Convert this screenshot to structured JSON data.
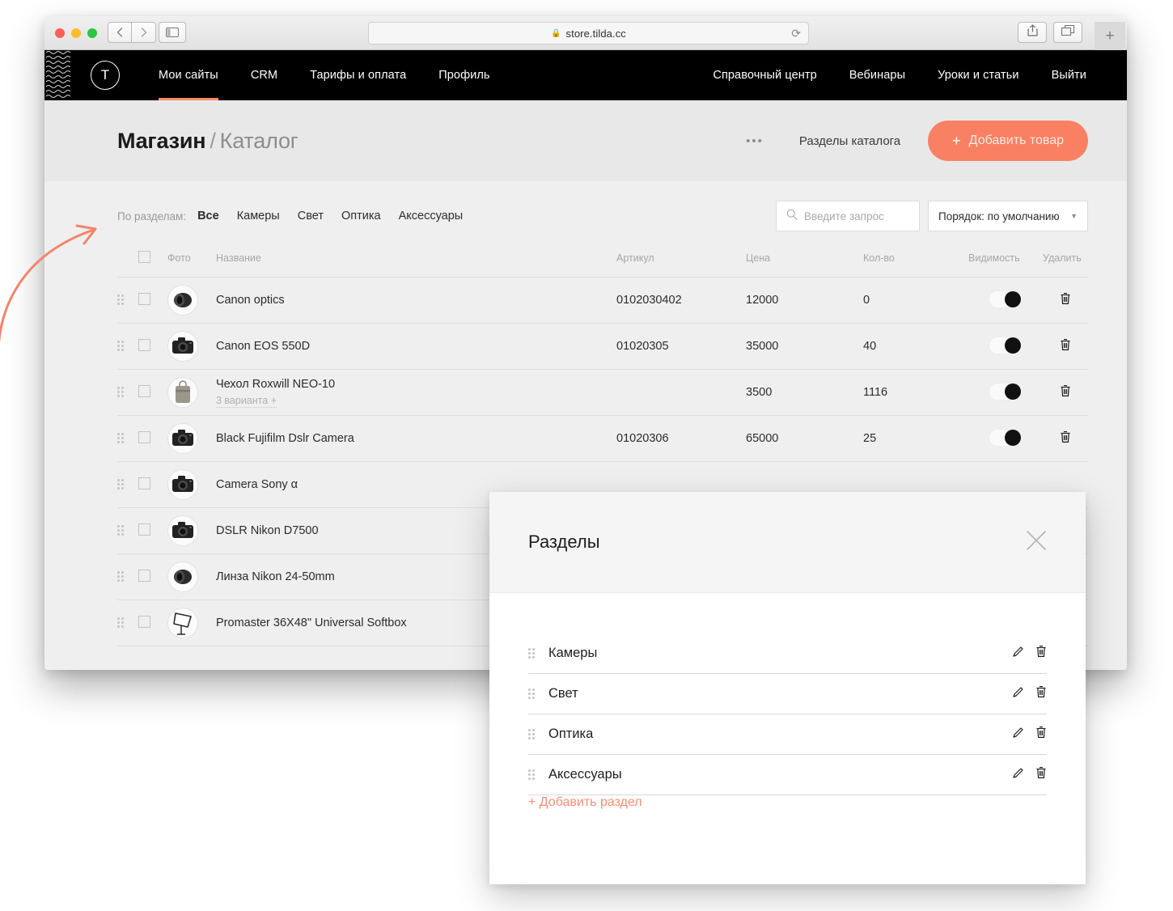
{
  "browser": {
    "url": "store.tilda.cc",
    "lock_icon": "lock-icon",
    "reload_icon": "reload-icon",
    "back_icon": "chevron-left-icon",
    "forward_icon": "chevron-right-icon",
    "sidebar_icon": "sidebar-toggle-icon",
    "share_icon": "share-icon",
    "tabs_icon": "show-tabs-icon",
    "newtab_label": "+"
  },
  "topnav": {
    "logo": "T",
    "left_items": [
      {
        "label": "Мои сайты",
        "active": true
      },
      {
        "label": "CRM",
        "active": false
      },
      {
        "label": "Тарифы и оплата",
        "active": false
      },
      {
        "label": "Профиль",
        "active": false
      }
    ],
    "right_items": [
      {
        "label": "Справочный центр"
      },
      {
        "label": "Вебинары"
      },
      {
        "label": "Уроки и статьи"
      },
      {
        "label": "Выйти"
      }
    ]
  },
  "pagehead": {
    "crumb_primary": "Магазин",
    "crumb_separator": "/",
    "crumb_secondary": "Каталог",
    "more_dots": "•••",
    "sections_link": "Разделы каталога",
    "add_button_plus": "+",
    "add_button_label": "Добавить товар",
    "accent_color": "#fa8064"
  },
  "filters": {
    "label": "По разделам:",
    "chips": [
      {
        "label": "Все",
        "selected": true
      },
      {
        "label": "Камеры",
        "selected": false
      },
      {
        "label": "Свет",
        "selected": false
      },
      {
        "label": "Оптика",
        "selected": false
      },
      {
        "label": "Аксессуары",
        "selected": false
      }
    ],
    "search_placeholder": "Введите запрос",
    "search_value": "",
    "sort_value": "Порядок: по умолчанию"
  },
  "table": {
    "columns": [
      "Фото",
      "Название",
      "Артикул",
      "Цена",
      "Кол-во",
      "Видимость",
      "Удалить"
    ],
    "rows": [
      {
        "name": "Canon optics",
        "variants": "",
        "sku": "0102030402",
        "price": "12000",
        "qty": "0",
        "visible": true,
        "icon": "lens-icon"
      },
      {
        "name": "Canon EOS 550D",
        "variants": "",
        "sku": "01020305",
        "price": "35000",
        "qty": "40",
        "visible": true,
        "icon": "camera-icon"
      },
      {
        "name": "Чехол Roxwill NEO-10",
        "variants": "3 варианта +",
        "sku": "",
        "price": "3500",
        "qty": "1116",
        "visible": true,
        "icon": "bag-icon"
      },
      {
        "name": "Black Fujifilm Dslr Camera",
        "variants": "",
        "sku": "01020306",
        "price": "65000",
        "qty": "25",
        "visible": true,
        "icon": "camera-icon"
      },
      {
        "name": "Camera Sony α",
        "variants": "",
        "sku": "",
        "price": "",
        "qty": "",
        "visible": false,
        "icon": "camera-icon"
      },
      {
        "name": "DSLR Nikon D7500",
        "variants": "",
        "sku": "",
        "price": "",
        "qty": "",
        "visible": false,
        "icon": "camera-icon"
      },
      {
        "name": "Линза Nikon 24-50mm",
        "variants": "",
        "sku": "",
        "price": "",
        "qty": "",
        "visible": false,
        "icon": "lens-icon"
      },
      {
        "name": "Promaster 36X48\" Universal Softbox",
        "variants": "",
        "sku": "",
        "price": "",
        "qty": "",
        "visible": false,
        "icon": "softbox-icon"
      }
    ]
  },
  "modal": {
    "title": "Разделы",
    "close_icon": "close-icon",
    "sections": [
      {
        "label": "Камеры"
      },
      {
        "label": "Свет"
      },
      {
        "label": "Оптика"
      },
      {
        "label": "Аксессуары"
      }
    ],
    "add_label": "+ Добавить раздел",
    "accent_color": "#f98d72"
  },
  "annotation": {
    "arrow_color": "#f4836b"
  }
}
